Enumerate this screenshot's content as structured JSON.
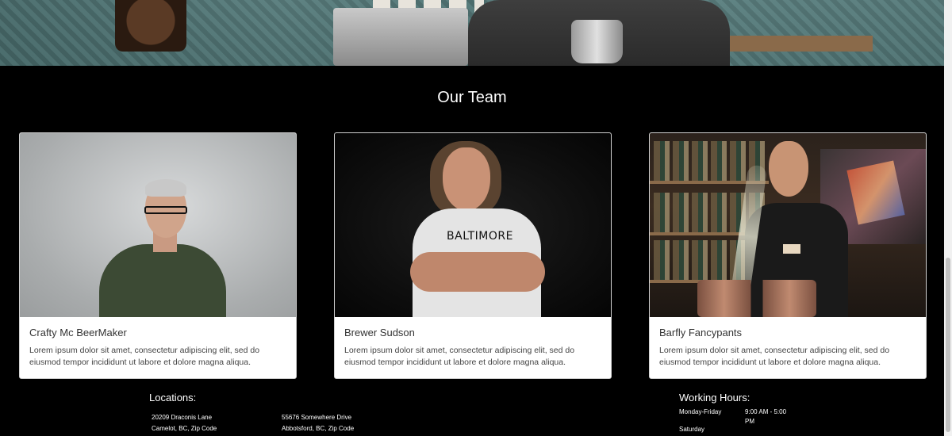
{
  "team": {
    "title": "Our Team",
    "members": [
      {
        "name": "Crafty Mc BeerMaker",
        "description": "Lorem ipsum dolor sit amet, consectetur adipiscing elit, sed do eiusmod tempor incididunt ut labore et dolore magna aliqua."
      },
      {
        "name": "Brewer Sudson",
        "description": "Lorem ipsum dolor sit amet, consectetur adipiscing elit, sed do eiusmod tempor incididunt ut labore et dolore magna aliqua.",
        "shirt_text": "BALTIMORE"
      },
      {
        "name": "Barfly Fancypants",
        "description": "Lorem ipsum dolor sit amet, consectetur adipiscing elit, sed do eiusmod tempor incididunt ut labore et dolore magna aliqua."
      }
    ]
  },
  "footer": {
    "locations": {
      "heading": "Locations:",
      "items": [
        {
          "street": "20209 Draconis Lane",
          "city": "Camelot, BC, Zip Code"
        },
        {
          "street": "55676 Somewhere Drive",
          "city": "Abbotsford, BC, Zip Code"
        }
      ]
    },
    "hours": {
      "heading": "Working Hours:",
      "rows": [
        {
          "days": "Monday-Friday",
          "time_line1": "9:00 AM - 5:00",
          "time_line2": "PM"
        },
        {
          "days": "Saturday",
          "time_line1": "",
          "time_line2": ""
        }
      ]
    }
  },
  "colors": {
    "background": "#000000",
    "card": "#ffffff",
    "text_light": "#ffffff",
    "text_dark": "#333333"
  }
}
